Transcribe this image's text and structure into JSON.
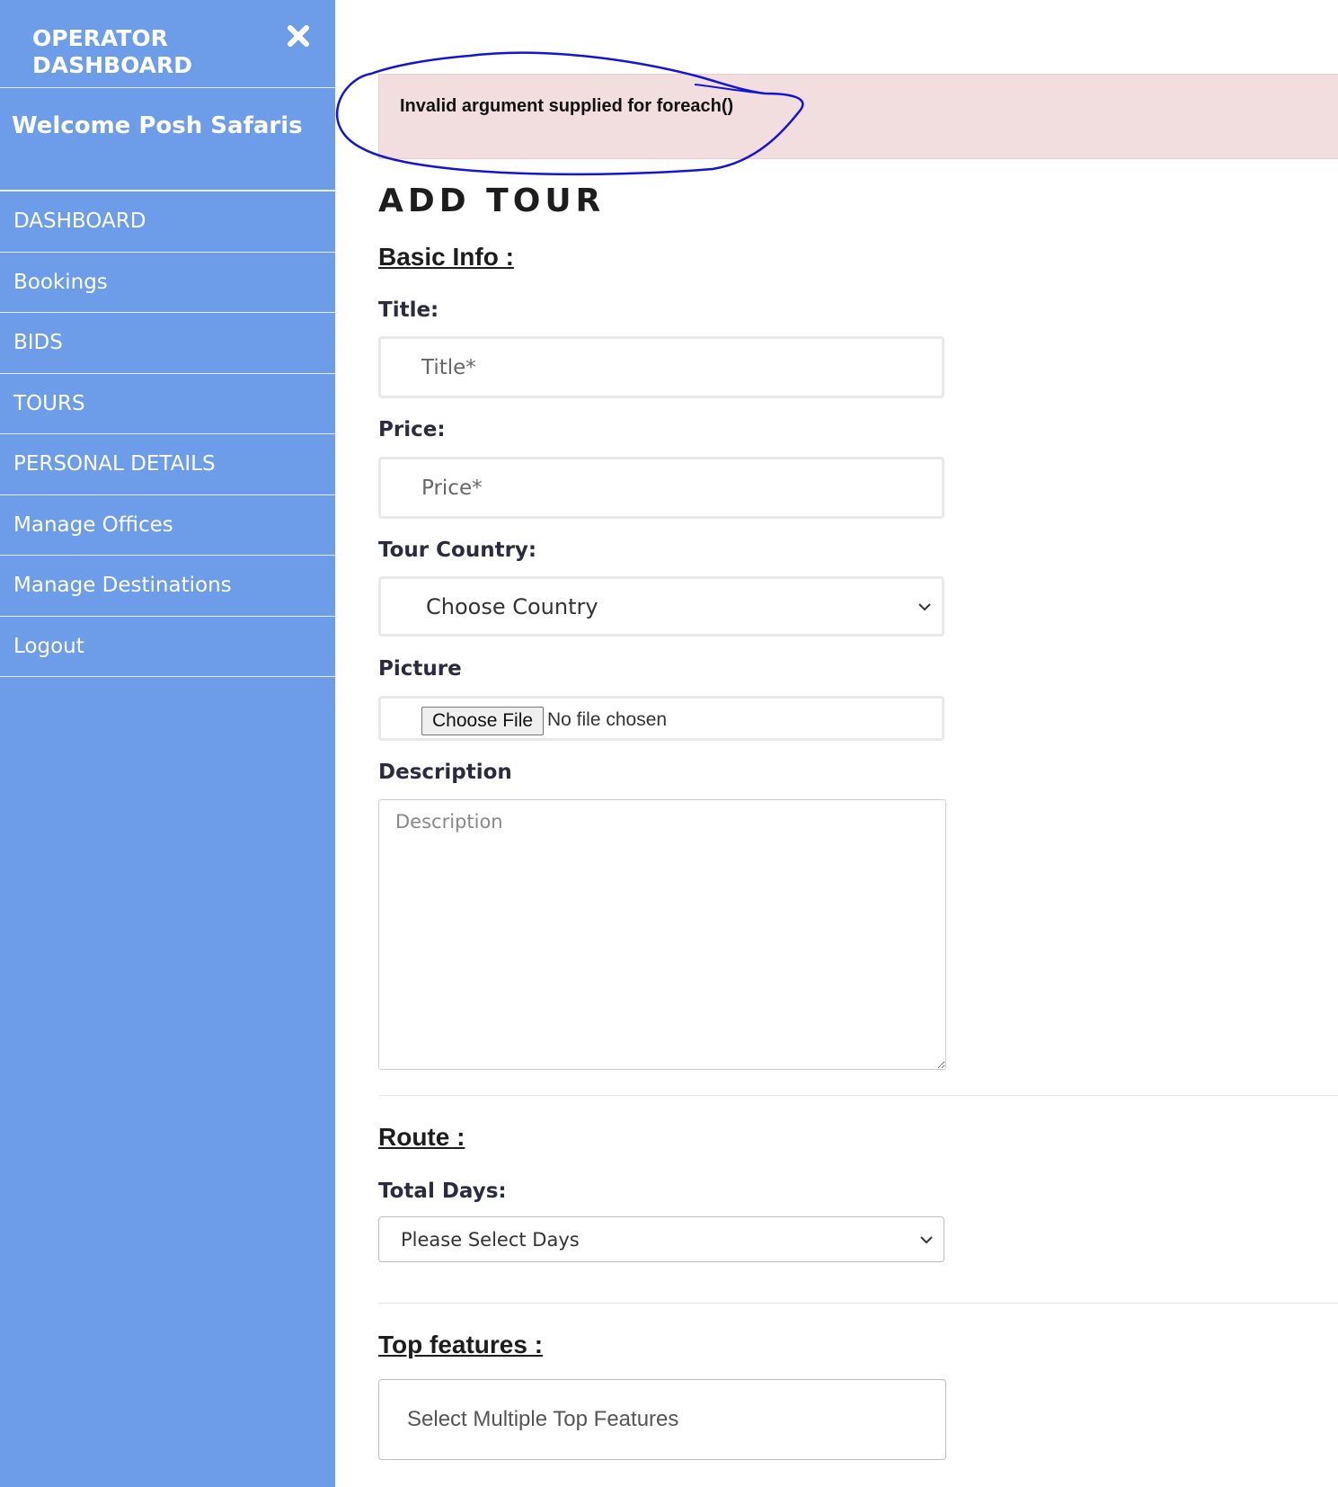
{
  "sidebar": {
    "title": "OPERATOR DASHBOARD",
    "close_icon": "close-icon",
    "welcome": "Welcome Posh Safaris",
    "items": [
      {
        "label": "DASHBOARD"
      },
      {
        "label": "Bookings"
      },
      {
        "label": "BIDS"
      },
      {
        "label": "TOURS"
      },
      {
        "label": "PERSONAL DETAILS"
      },
      {
        "label": "Manage Offices"
      },
      {
        "label": "Manage Destinations"
      },
      {
        "label": "Logout"
      }
    ],
    "color": "#6d9de8"
  },
  "error": {
    "message": "Invalid argument supplied for foreach()",
    "bg_color": "#f2dede",
    "annotation_color": "#1414d6"
  },
  "form": {
    "heading": "ADD TOUR",
    "basic_info": "Basic Info :",
    "title_label": "Title:",
    "title_placeholder": "Title*",
    "price_label": "Price:",
    "price_placeholder": "Price*",
    "country_label": "Tour Country:",
    "country_value": "Choose Country",
    "picture_label": "Picture",
    "file_button": "Choose File",
    "file_status": "No file chosen",
    "description_label": "Description",
    "description_placeholder": "Description",
    "route": "Route :",
    "total_days_label": "Total Days:",
    "total_days_value": "Please Select Days",
    "top_features": "Top features :",
    "top_features_placeholder": "Select Multiple Top Features"
  }
}
